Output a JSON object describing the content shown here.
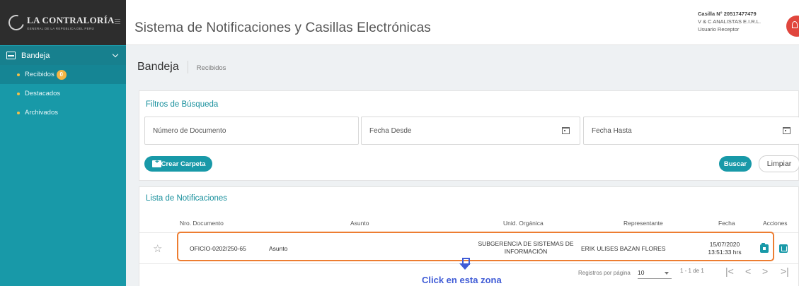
{
  "brand": {
    "name": "LA CONTRALORÍA",
    "subtitle": "GENERAL DE LA REPÚBLICA DEL PERÚ"
  },
  "header": {
    "title": "Sistema de Notificaciones y Casillas Electrónicas",
    "casilla": "Casilla N° 20517477479",
    "company": "V & C ANALISTAS E.I.R.L.",
    "role": "Usuario Receptor"
  },
  "sidebar": {
    "section": "Bandeja",
    "items": [
      {
        "label": "Recibidos",
        "badge": "0"
      },
      {
        "label": "Destacados"
      },
      {
        "label": "Archivados"
      }
    ]
  },
  "breadcrumb": {
    "title": "Bandeja",
    "sub": "Recibidos"
  },
  "filters": {
    "title": "Filtros de Búsqueda",
    "doc_placeholder": "Número de Documento",
    "from_placeholder": "Fecha Desde",
    "to_placeholder": "Fecha Hasta",
    "create_folder": "Crear Carpeta",
    "search": "Buscar",
    "clear": "Limpiar"
  },
  "list": {
    "title": "Lista de Notificaciones",
    "columns": [
      "Nro. Documento",
      "Asunto",
      "Unid. Orgánica",
      "Representante",
      "Fecha",
      "Acciones"
    ],
    "rows": [
      {
        "doc": "OFICIO-0202/250-65",
        "subject": "Asunto",
        "unit_line1": "SUBGERENCIA DE SISTEMAS DE",
        "unit_line2": "INFORMACIÓN",
        "representative": "ERIK ULISES BAZAN FLORES",
        "date": "15/07/2020",
        "time": "13:51:33 hrs"
      }
    ],
    "per_page_label": "Registros por página",
    "per_page": "10",
    "range": "1 - 1 de 1",
    "nav": [
      "|<",
      "<",
      ">",
      ">|"
    ]
  },
  "annotation": "Click en esta zona",
  "colors": {
    "primary": "#1899a8",
    "highlight": "#ed7d31",
    "annotation": "#3f5bd6",
    "badge": "#f5b544"
  }
}
